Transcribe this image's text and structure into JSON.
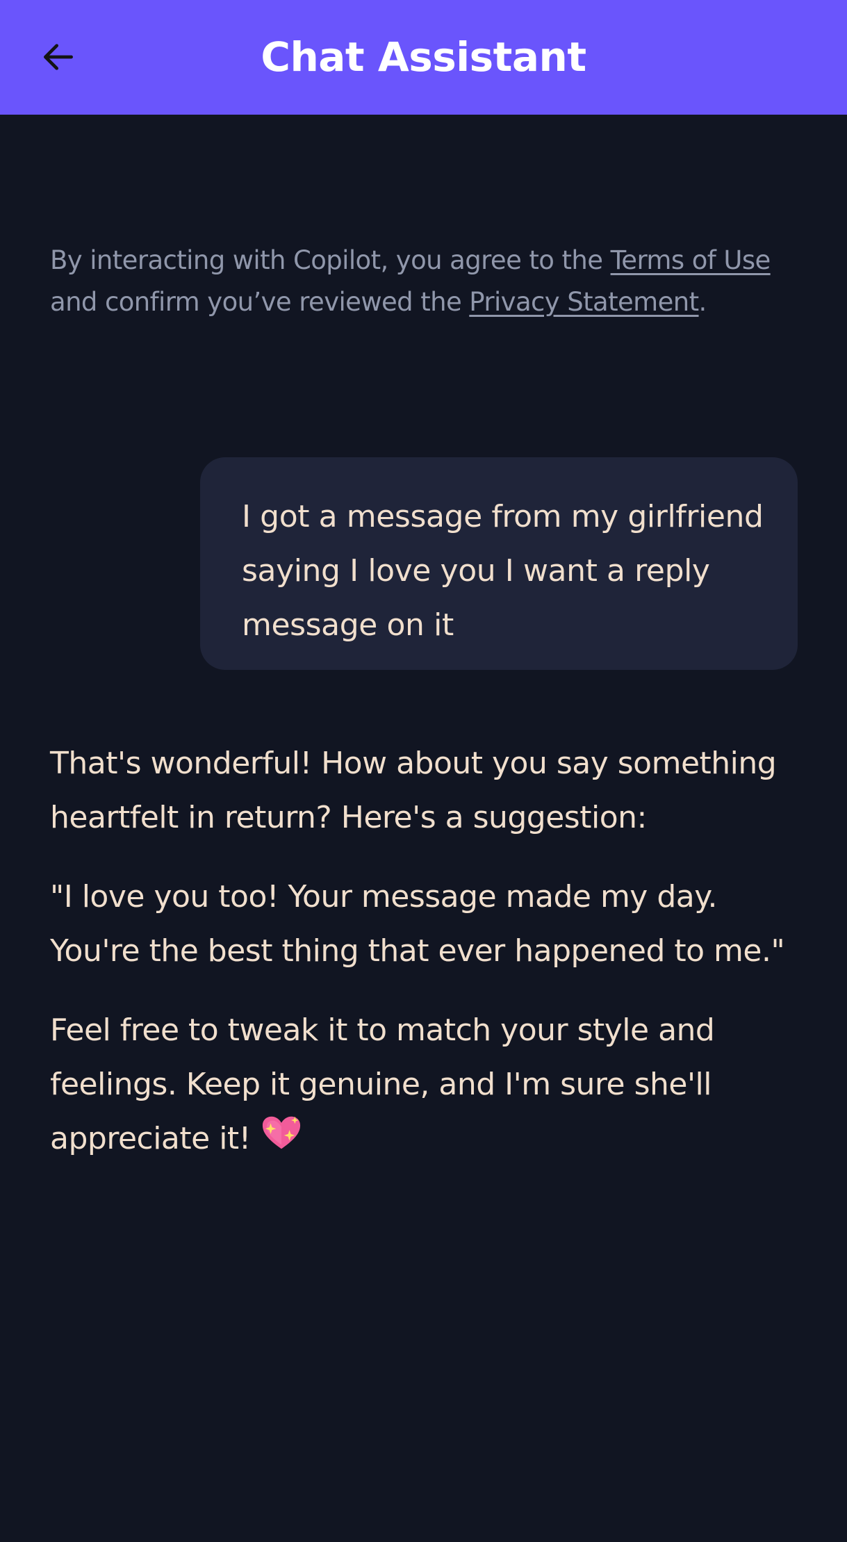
{
  "header": {
    "title": "Chat Assistant",
    "back_icon": "arrow-left-icon",
    "background": "#6a55fc"
  },
  "disclaimer": {
    "prefix": "By interacting with Copilot, you agree to the ",
    "terms_link": "Terms of Use",
    "middle": " and confirm you’ve reviewed the ",
    "privacy_link": "Privacy Statement",
    "suffix": "."
  },
  "messages": {
    "user": {
      "text": "I got a message from my girlfriend saying I love you I want a reply message on it"
    },
    "assistant": {
      "paragraph1": "That's wonderful! How about you say something heartfelt in return? Here's a suggestion:",
      "paragraph2": "\"I love you too! Your message made my day. You're the best thing that ever happened to me.\"",
      "paragraph3": "Feel free to tweak it to match your style and feelings. Keep it genuine, and I'm sure she'll appreciate it! ",
      "emoji_icon": "sparkling-heart-icon"
    }
  },
  "colors": {
    "background": "#111522",
    "user_bubble": "#1f2439",
    "message_text": "#f1dfcd",
    "disclaimer_text": "#9097ab"
  }
}
